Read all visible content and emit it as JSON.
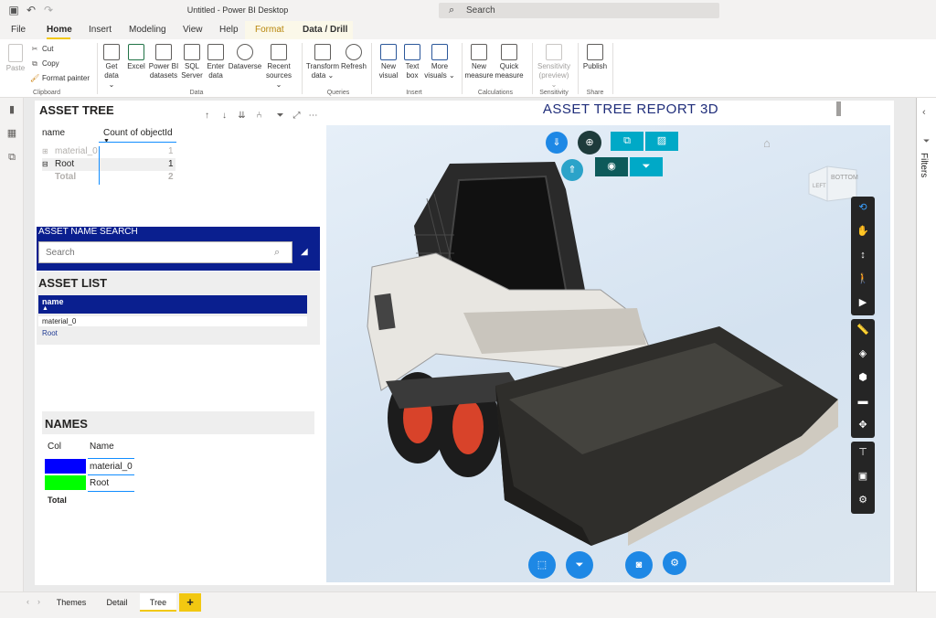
{
  "window": {
    "title": "Untitled - Power BI Desktop",
    "search_placeholder": "Search"
  },
  "ribbon_tabs": [
    "File",
    "Home",
    "Insert",
    "Modeling",
    "View",
    "Help",
    "Format",
    "Data / Drill"
  ],
  "ribbon": {
    "clipboard": {
      "paste": "Paste",
      "cut": "Cut",
      "copy": "Copy",
      "format_painter": "Format painter",
      "label": "Clipboard"
    },
    "data": {
      "get_data": [
        "Get",
        "data ⌄"
      ],
      "excel": "Excel",
      "pbi_datasets": [
        "Power BI",
        "datasets"
      ],
      "sql_server": [
        "SQL",
        "Server"
      ],
      "enter_data": [
        "Enter",
        "data"
      ],
      "dataverse": "Dataverse",
      "recent_sources": [
        "Recent",
        "sources ⌄"
      ],
      "label": "Data"
    },
    "queries": {
      "transform": [
        "Transform",
        "data ⌄"
      ],
      "refresh": "Refresh",
      "label": "Queries"
    },
    "insert": {
      "new_visual": [
        "New",
        "visual"
      ],
      "text_box": [
        "Text",
        "box"
      ],
      "more_visuals": [
        "More",
        "visuals ⌄"
      ],
      "label": "Insert"
    },
    "calculations": {
      "new_measure": [
        "New",
        "measure"
      ],
      "quick_measure": [
        "Quick",
        "measure"
      ],
      "label": "Calculations"
    },
    "sensitivity": {
      "button": [
        "Sensitivity",
        "(preview) ⌄"
      ],
      "label": "Sensitivity"
    },
    "share": {
      "publish": "Publish",
      "label": "Share"
    }
  },
  "asset_tree": {
    "title": "ASSET TREE",
    "col_name": "name",
    "col_count": "Count of objectId",
    "rows": [
      {
        "name": "material_0",
        "count": "1"
      },
      {
        "name": "Root",
        "count": "1"
      }
    ],
    "total_label": "Total",
    "total_value": "2"
  },
  "asset_search": {
    "title": "ASSET NAME SEARCH",
    "placeholder": "Search"
  },
  "asset_list": {
    "title": "ASSET LIST",
    "header": "name",
    "rows": [
      "material_0",
      "Root"
    ]
  },
  "names": {
    "title": "NAMES",
    "col1": "Col",
    "col2": "Name",
    "rows": [
      {
        "color": "#0000ff",
        "name": "material_0"
      },
      {
        "color": "#00ff00",
        "name": "Root"
      }
    ],
    "total_label": "Total"
  },
  "viewer": {
    "title": "ASSET TREE REPORT 3D",
    "cube_labels": [
      "LEFT",
      "BOTTOM"
    ]
  },
  "page_tabs": [
    "Themes",
    "Detail",
    "Tree"
  ],
  "add_page": "+",
  "colors": {
    "accent": "#f2c811",
    "navy": "#0a1f8f",
    "viewer_blue": "#1e88e5",
    "teal": "#00a9c7"
  }
}
